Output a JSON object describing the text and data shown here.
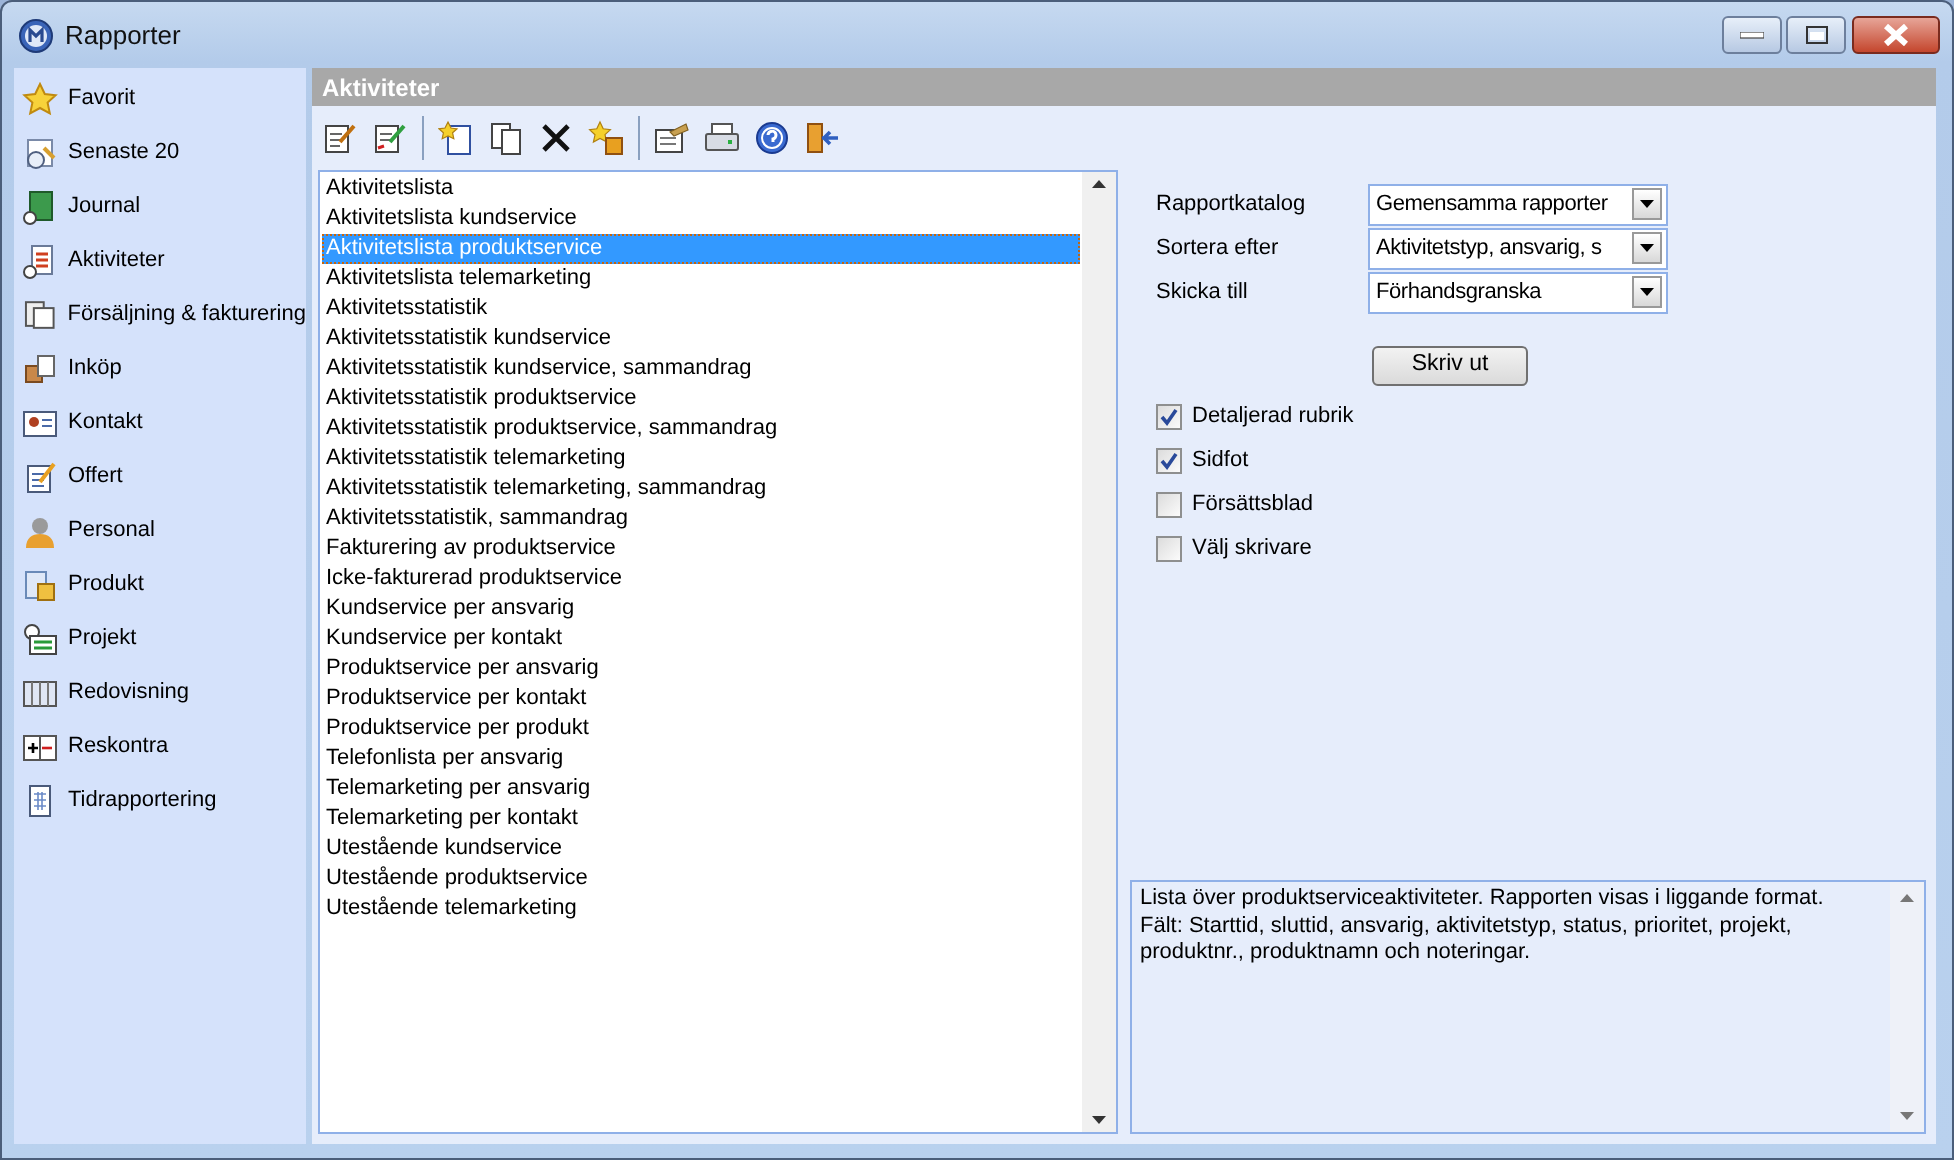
{
  "window": {
    "title": "Rapporter"
  },
  "sidebar": {
    "items": [
      {
        "label": "Favorit"
      },
      {
        "label": "Senaste 20"
      },
      {
        "label": "Journal"
      },
      {
        "label": "Aktiviteter"
      },
      {
        "label": "Försäljning & fakturering"
      },
      {
        "label": "Inköp"
      },
      {
        "label": "Kontakt"
      },
      {
        "label": "Offert"
      },
      {
        "label": "Personal"
      },
      {
        "label": "Produkt"
      },
      {
        "label": "Projekt"
      },
      {
        "label": "Redovisning"
      },
      {
        "label": "Reskontra"
      },
      {
        "label": "Tidrapportering"
      }
    ]
  },
  "panel": {
    "title": "Aktiviteter"
  },
  "reports": [
    {
      "label": "Aktivitetslista",
      "selected": false
    },
    {
      "label": "Aktivitetslista kundservice",
      "selected": false
    },
    {
      "label": "Aktivitetslista produktservice",
      "selected": true
    },
    {
      "label": "Aktivitetslista telemarketing",
      "selected": false
    },
    {
      "label": "Aktivitetsstatistik",
      "selected": false
    },
    {
      "label": "Aktivitetsstatistik kundservice",
      "selected": false
    },
    {
      "label": "Aktivitetsstatistik kundservice, sammandrag",
      "selected": false
    },
    {
      "label": "Aktivitetsstatistik produktservice",
      "selected": false
    },
    {
      "label": "Aktivitetsstatistik produktservice, sammandrag",
      "selected": false
    },
    {
      "label": "Aktivitetsstatistik telemarketing",
      "selected": false
    },
    {
      "label": "Aktivitetsstatistik telemarketing, sammandrag",
      "selected": false
    },
    {
      "label": "Aktivitetsstatistik, sammandrag",
      "selected": false
    },
    {
      "label": "Fakturering av produktservice",
      "selected": false
    },
    {
      "label": "Icke-fakturerad produktservice",
      "selected": false
    },
    {
      "label": "Kundservice per ansvarig",
      "selected": false
    },
    {
      "label": "Kundservice per kontakt",
      "selected": false
    },
    {
      "label": "Produktservice per ansvarig",
      "selected": false
    },
    {
      "label": "Produktservice per kontakt",
      "selected": false
    },
    {
      "label": "Produktservice per produkt",
      "selected": false
    },
    {
      "label": "Telefonlista per ansvarig",
      "selected": false
    },
    {
      "label": "Telemarketing per ansvarig",
      "selected": false
    },
    {
      "label": "Telemarketing per kontakt",
      "selected": false
    },
    {
      "label": "Utestående kundservice",
      "selected": false
    },
    {
      "label": "Utestående produktservice",
      "selected": false
    },
    {
      "label": "Utestående telemarketing",
      "selected": false
    }
  ],
  "settings": [
    {
      "label": "Rapportkatalog",
      "value": "Gemensamma rapporter"
    },
    {
      "label": "Sortera efter",
      "value": "Aktivitetstyp, ansvarig, s"
    },
    {
      "label": "Skicka till",
      "value": "Förhandsgranska"
    }
  ],
  "print_button": "Skriv ut",
  "options": [
    {
      "label": "Detaljerad rubrik",
      "checked": true
    },
    {
      "label": "Sidfot",
      "checked": true
    },
    {
      "label": "Försättsblad",
      "checked": false
    },
    {
      "label": "Välj skrivare",
      "checked": false
    }
  ],
  "description": [
    "Lista över produktserviceaktiviteter. Rapporten visas i liggande format.",
    "Fält: Starttid, sluttid, ansvarig, aktivitetstyp, status, prioritet, projekt, produktnr., produktnamn och noteringar."
  ]
}
